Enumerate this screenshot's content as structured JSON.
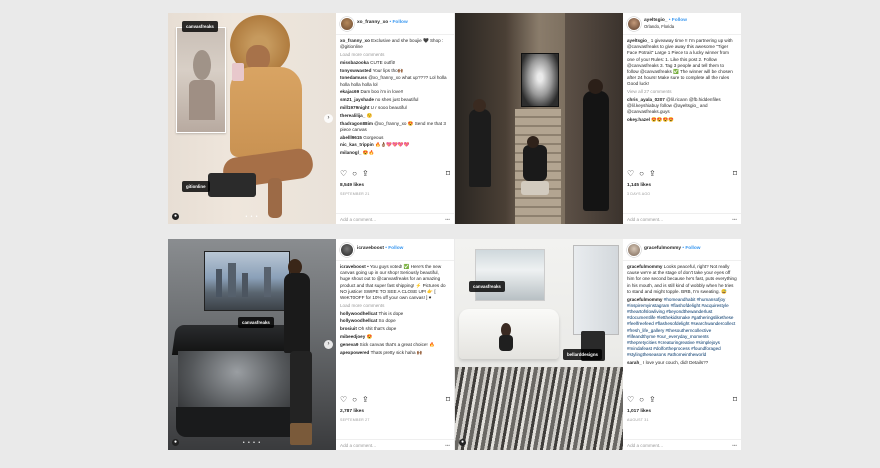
{
  "posts": [
    {
      "username": "xo_franny_xo",
      "follow": "• Follow",
      "location": "",
      "caption": "Exclusive and she boujie 🖤 Shop : @gitionline",
      "load_more": "Load more comments",
      "comments": [
        {
          "user": "missbazooka",
          "text": "CUTE outfit!"
        },
        {
          "user": "tonyswwasted",
          "text": "Your lips tho🙌🏾"
        },
        {
          "user": "tonedamuss",
          "text": "@xo_franny_xo what up???? Lol holla holla holla holla lol"
        },
        {
          "user": "ekajac69",
          "text": "Dam boo i'm in love!!"
        },
        {
          "user": "sm21_jayshade",
          "text": "no shes just beautiful"
        },
        {
          "user": "mill1979night",
          "text": "U r sooo beautiful"
        },
        {
          "user": "therealilija_",
          "text": "😚"
        },
        {
          "user": "thadragon88im",
          "text": "@xo_franny_xo 😍 Send me that 3 piece canvas"
        },
        {
          "user": "abelll9615",
          "text": "Gorgeous"
        },
        {
          "user": "nic_kas_trippin",
          "text": "🔥👌🏾💖💖💖💖"
        },
        {
          "user": "milanogl_",
          "text": "😍🔥"
        }
      ],
      "likes": "8,549 likes",
      "date": "SEPTEMBER 21",
      "add_comment": "Add a comment...",
      "image_tags": [
        "canvasfreaks",
        "gitionline"
      ]
    },
    {
      "username": "ayeltsgio_",
      "follow": "• Follow",
      "location": "Orlando, Florida",
      "caption": "1 giveaway time !! I'm partnering up with @canvasfreaks to give away this awesome \"Tiger Face Potrait\" Large 1 Piece to a lucky winner from one of you! Rules: 1. Like this post 2. Follow @canvasfreaks 3. Tag 3 people and tell them to follow @canvasfreaks ✅ The winner will be chosen after 24 hours! Make sure to complete all the rules Good luck!",
      "load_more": "View all 27 comments",
      "comments": [
        {
          "user": "chris_ayala_0207",
          "text": "@lil.ricann @fb.hiddenfiles @lil.keyshiabuy follow @ayeltsgio_ and @canvasfreaks.guys"
        },
        {
          "user": "okey.hazel",
          "text": "😍😍😍😍"
        }
      ],
      "likes": "1,145 likes",
      "date": "3 DAYS AGO",
      "add_comment": "Add a comment...",
      "image_tags": []
    },
    {
      "username": "icraveboost",
      "follow": "• Follow",
      "location": "",
      "caption": "• You guys voted! ✅ Here's the new canvas going up in our shop! Seriously beautiful, huge shout out to @canvasfreaks for an amazing product and that super fast shipping! ⚡️ Pictures do NO justice! SWIPE TO SEE A CLOSE UP! 👉 [ WeKT0OFF for 10% off your own canvas! ] ♥",
      "load_more": "Load more comments",
      "comments": [
        {
          "user": "hollywoodhellcat",
          "text": "This is dope"
        },
        {
          "user": "hollywoodhellcat",
          "text": "So dope"
        },
        {
          "user": "brosiuit",
          "text": "Oh shit that's dope"
        },
        {
          "user": "mibeedjoey",
          "text": "😍"
        },
        {
          "user": "geneva9",
          "text": "Sick canvas that's a great choice! 🔥"
        },
        {
          "user": "apexpowered",
          "text": "Thats pretty sick haha 🙌🏾"
        }
      ],
      "likes": "2,787 likes",
      "date": "SEPTEMBER 27",
      "add_comment": "Add a comment...",
      "image_tags": [
        "canvasfreaks"
      ]
    },
    {
      "username": "gracefulmommy",
      "follow": "• Follow",
      "location": "",
      "caption": "Looks peaceful, right? Not really cause we're at the stage of don't take your eyes off him for one second because he's fast, puts everything in his mouth, and is still kind of wobbly when he tries to stand and might topple. BRB, I'm sweating. 😅",
      "load_more": "",
      "comments": [
        {
          "user": "gracefulmommy",
          "text": "#homeandhabit #humansofjoy #inspiremyinstagram #flashofdelight #acquirestyle #theartofslowliving #beyondthewanderlust #documentlife #letthekidsmake #gatheringslikethese #feelfreefeed #flashesofdelight #searchwandercollect #fresh_life_gallery #thesoutherncollective #lifeandthyme #our_everyday_moments #thepretycities #creaturingreative #simplejoys #mindafeast #dolfortheprocess #foundforaged #stylingtheseasons #athomeintheworld"
        },
        {
          "user": "sarah_",
          "text": "I love your couch, did! Details??"
        }
      ],
      "likes": "1,017 likes",
      "date": "AUGUST 31",
      "add_comment": "Add a comment...",
      "image_tags": [
        "canvasfreaks",
        "bellarddesigns"
      ]
    }
  ],
  "icons": {
    "like": "heart-icon",
    "comment": "comment-icon",
    "share": "share-icon",
    "save": "bookmark-icon",
    "more": "more-dots-icon"
  },
  "colors": {
    "follow": "#3897f0",
    "background": "#eaeaea"
  }
}
